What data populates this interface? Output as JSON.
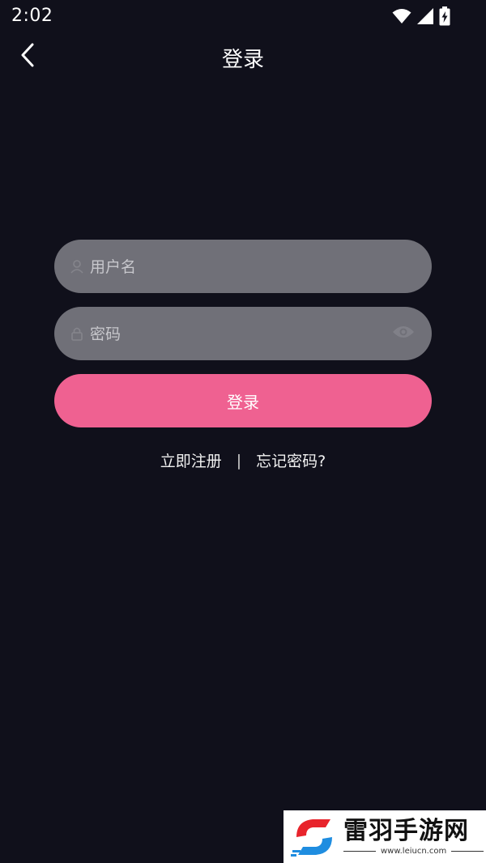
{
  "status_bar": {
    "time": "2:02",
    "icons": [
      "wifi-icon",
      "signal-icon",
      "battery-charging-icon"
    ]
  },
  "app_bar": {
    "back_icon": "chevron-left-icon",
    "title": "登录"
  },
  "form": {
    "username": {
      "icon": "user-icon",
      "placeholder": "用户名",
      "value": ""
    },
    "password": {
      "icon": "lock-icon",
      "placeholder": "密码",
      "value": "",
      "toggle_icon": "eye-icon"
    },
    "login_label": "登录"
  },
  "links": {
    "register": "立即注册",
    "separator": "|",
    "forgot": "忘记密码?"
  },
  "watermark": {
    "name": "雷羽手游网",
    "url": "www.leiucn.com"
  },
  "colors": {
    "background": "#10101b",
    "field": "#707078",
    "accent": "#ef6191"
  }
}
